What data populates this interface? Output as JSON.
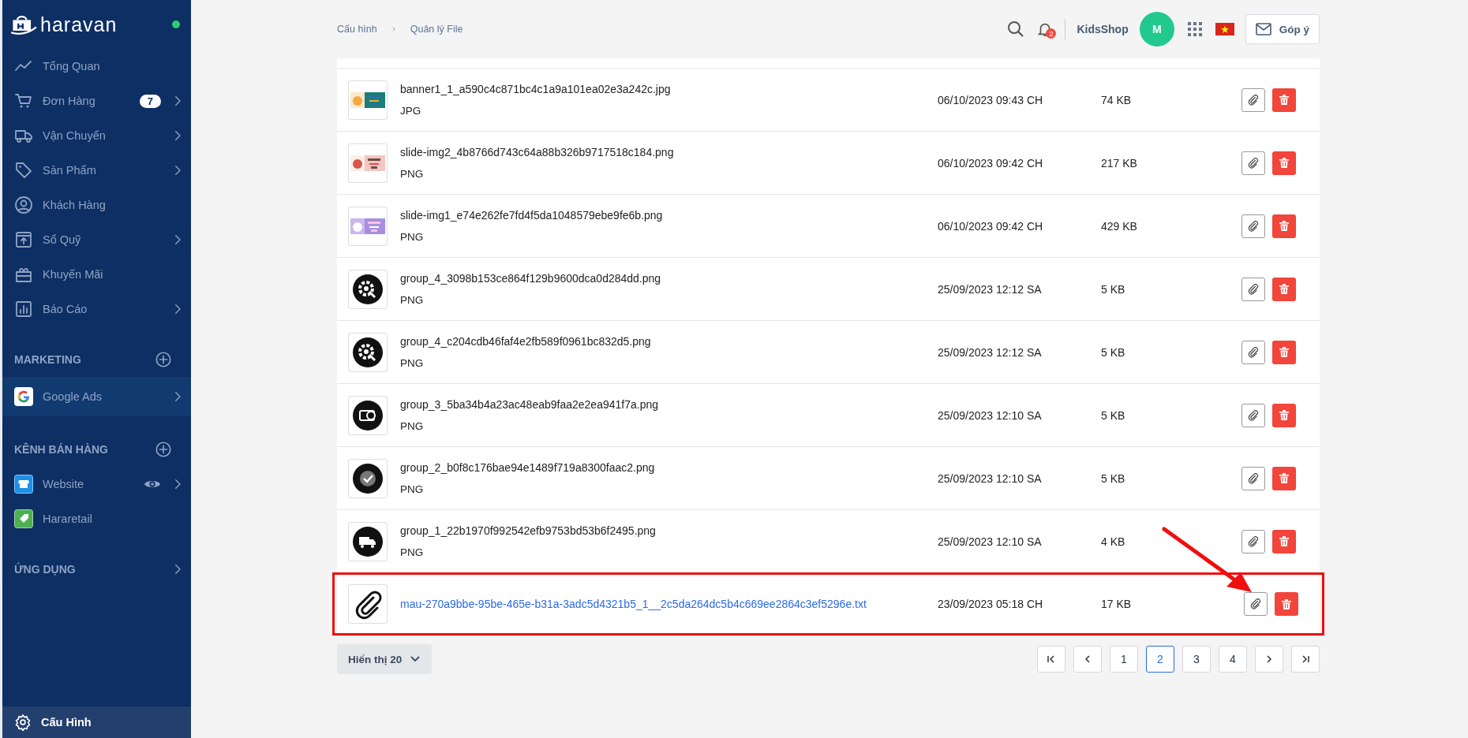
{
  "sidebar": {
    "brand": "haravan",
    "online": true,
    "items": [
      {
        "label": "Tổng Quan",
        "submenu": false
      },
      {
        "label": "Đơn Hàng",
        "badge": "7",
        "submenu": true
      },
      {
        "label": "Vận Chuyển",
        "submenu": true
      },
      {
        "label": "Sản Phẩm",
        "submenu": true
      },
      {
        "label": "Khách Hàng",
        "submenu": false
      },
      {
        "label": "Sổ Quỹ",
        "submenu": true
      },
      {
        "label": "Khuyến Mãi",
        "submenu": false
      },
      {
        "label": "Báo Cáo",
        "submenu": true
      }
    ],
    "sections": [
      {
        "title": "MARKETING",
        "add_button": true,
        "submenu": false,
        "items": [
          {
            "label": "Google Ads",
            "submenu": true,
            "eye": false,
            "highlighted": true
          }
        ]
      },
      {
        "title": "KÊNH BÁN HÀNG",
        "add_button": true,
        "submenu": false,
        "items": [
          {
            "label": "Website",
            "submenu": true,
            "eye": true,
            "highlighted": false
          },
          {
            "label": "Hararetail",
            "submenu": false,
            "eye": false,
            "highlighted": false
          }
        ]
      },
      {
        "title": "ỨNG DỤNG",
        "add_button": false,
        "submenu": true
      }
    ],
    "footer_item": {
      "label": "Cấu Hình",
      "selected": true
    }
  },
  "header": {
    "breadcrumb": [
      "Cấu hình",
      "Quản lý File"
    ],
    "notification_count": "2",
    "shop": "KidsShop",
    "avatar": "M",
    "feedback": "Góp ý"
  },
  "files": [
    {
      "name": "banner1_1_a590c4c871bc4c1a9a101ea02e3a242c.jpg",
      "type": "JPG",
      "date": "06/10/2023 09:43 CH",
      "size": "74 KB",
      "kind": "picture",
      "link": false,
      "highlighted": false
    },
    {
      "name": "slide-img2_4b8766d743c64a88b326b9717518c184.png",
      "type": "PNG",
      "date": "06/10/2023 09:42 CH",
      "size": "217 KB",
      "kind": "picture",
      "link": false,
      "highlighted": false
    },
    {
      "name": "slide-img1_e74e262fe7fd4f5da1048579ebe9fe6b.png",
      "type": "PNG",
      "date": "06/10/2023 09:42 CH",
      "size": "429 KB",
      "kind": "picture",
      "link": false,
      "highlighted": false
    },
    {
      "name": "group_4_3098b153ce864f129b9600dca0d284dd.png",
      "type": "PNG",
      "date": "25/09/2023 12:12 SA",
      "size": "5 KB",
      "kind": "icon",
      "link": false,
      "highlighted": false
    },
    {
      "name": "group_4_c204cdb46faf4e2fb589f0961bc832d5.png",
      "type": "PNG",
      "date": "25/09/2023 12:12 SA",
      "size": "5 KB",
      "kind": "icon",
      "link": false,
      "highlighted": false
    },
    {
      "name": "group_3_5ba34b4a23ac48eab9faa2e2ea941f7a.png",
      "type": "PNG",
      "date": "25/09/2023 12:10 SA",
      "size": "5 KB",
      "kind": "icon",
      "link": false,
      "highlighted": false
    },
    {
      "name": "group_2_b0f8c176bae94e1489f719a8300faac2.png",
      "type": "PNG",
      "date": "25/09/2023 12:10 SA",
      "size": "5 KB",
      "kind": "icon",
      "link": false,
      "highlighted": false
    },
    {
      "name": "group_1_22b1970f992542efb9753bd53b6f2495.png",
      "type": "PNG",
      "date": "25/09/2023 12:10 SA",
      "size": "4 KB",
      "kind": "icon",
      "link": false,
      "highlighted": false
    },
    {
      "name": "mau-270a9bbe-95be-465e-b31a-3adc5d4321b5_1__2c5da264dc5b4c669ee2864c3ef5296e.txt",
      "date": "23/09/2023 05:18 CH",
      "size": "17 KB",
      "kind": "icon",
      "link": true,
      "highlighted": true
    }
  ],
  "pagination": {
    "page_size": "Hiển thị 20",
    "pages": [
      {
        "label": "1",
        "selected": false
      },
      {
        "label": "2",
        "selected": true
      },
      {
        "label": "3",
        "selected": false
      },
      {
        "label": "4",
        "selected": false
      }
    ]
  }
}
